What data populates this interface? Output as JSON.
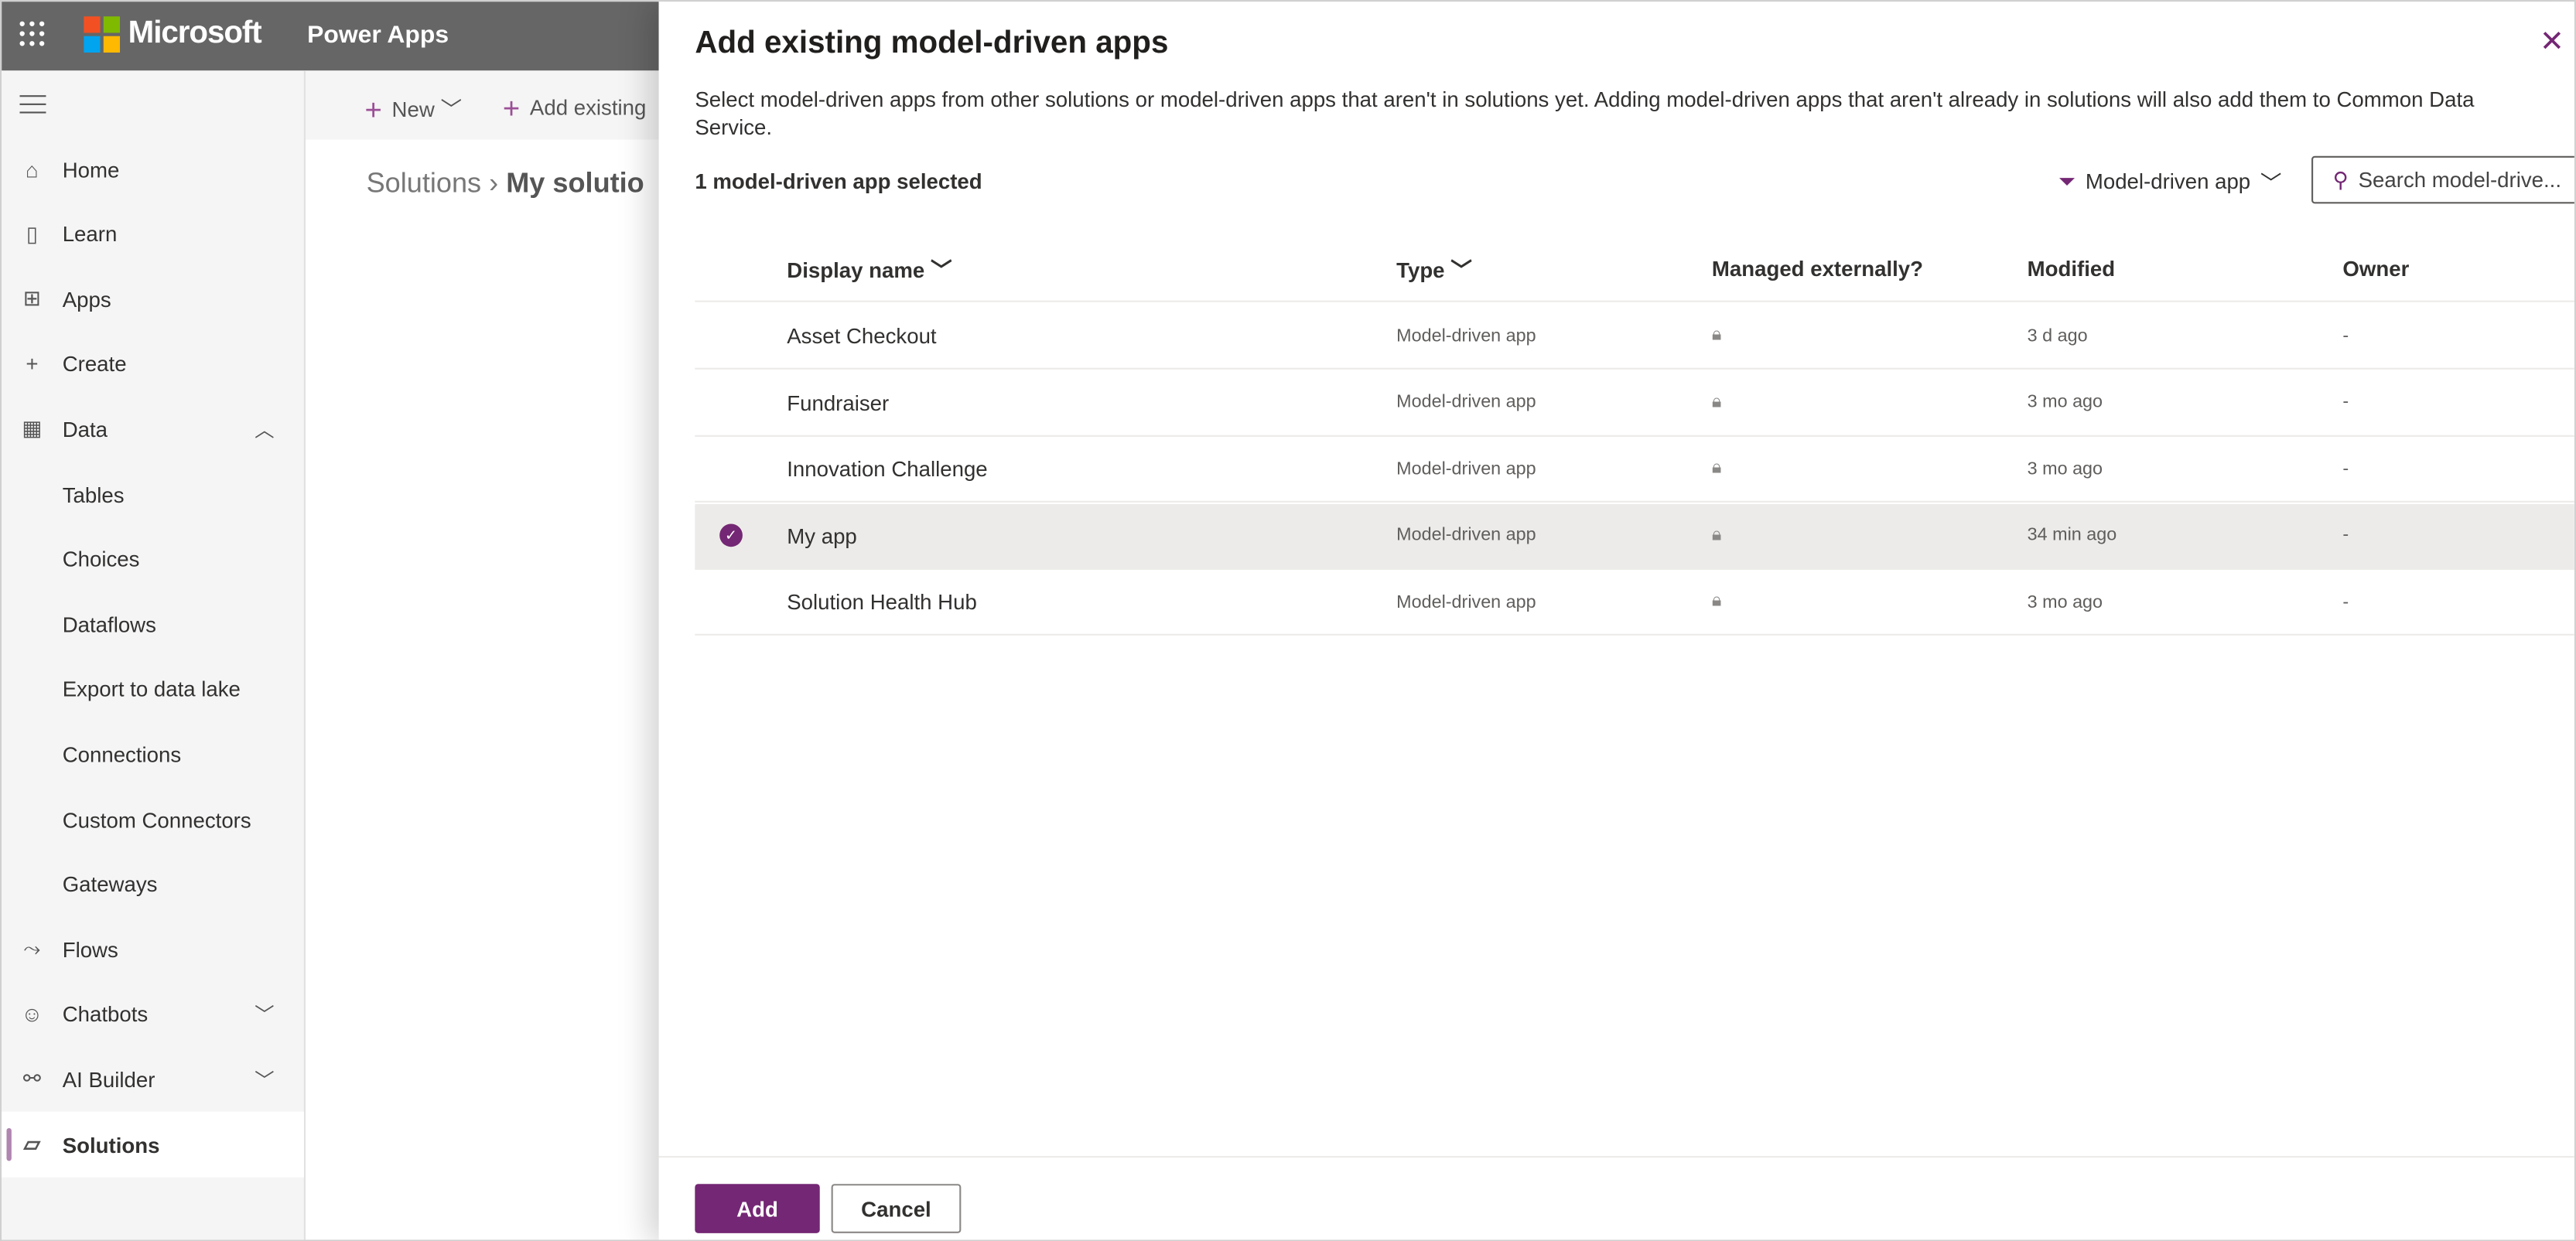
{
  "header": {
    "brand": "Microsoft",
    "app_name": "Power Apps",
    "logo_colors": [
      "#f25022",
      "#7fba00",
      "#00a4ef",
      "#ffb900"
    ]
  },
  "sidebar": {
    "items": [
      {
        "label": "Home",
        "icon": "home-icon",
        "glyph": "⌂"
      },
      {
        "label": "Learn",
        "icon": "book-icon",
        "glyph": "▯"
      },
      {
        "label": "Apps",
        "icon": "apps-icon",
        "glyph": "⊞"
      },
      {
        "label": "Create",
        "icon": "plus-icon",
        "glyph": "+"
      },
      {
        "label": "Data",
        "icon": "table-icon",
        "glyph": "▦",
        "chevron": "︿"
      },
      {
        "label": "Tables",
        "sub": true
      },
      {
        "label": "Choices",
        "sub": true
      },
      {
        "label": "Dataflows",
        "sub": true
      },
      {
        "label": "Export to data lake",
        "sub": true
      },
      {
        "label": "Connections",
        "sub": true
      },
      {
        "label": "Custom Connectors",
        "sub": true
      },
      {
        "label": "Gateways",
        "sub": true
      },
      {
        "label": "Flows",
        "icon": "flow-icon",
        "glyph": "⤳"
      },
      {
        "label": "Chatbots",
        "icon": "bot-icon",
        "glyph": "☺",
        "chevron": "﹀"
      },
      {
        "label": "AI Builder",
        "icon": "ai-icon",
        "glyph": "⚯",
        "chevron": "﹀"
      },
      {
        "label": "Solutions",
        "icon": "solutions-icon",
        "glyph": "▱",
        "selected": true
      }
    ]
  },
  "commandbar": {
    "new_label": "New",
    "add_existing_label": "Add existing"
  },
  "breadcrumb": {
    "root": "Solutions",
    "current": "My solutio"
  },
  "panel": {
    "title": "Add existing model-driven apps",
    "description": "Select model-driven apps from other solutions or model-driven apps that aren't in solutions yet. Adding model-driven apps that aren't already in solutions will also add them to Common Data Service.",
    "selected_count": "1 model-driven app selected",
    "filter_label": "Model-driven app",
    "search_placeholder": "Search model-drive...",
    "columns": [
      "Display name",
      "Type",
      "Managed externally?",
      "Modified",
      "Owner"
    ],
    "rows": [
      {
        "name": "Asset Checkout",
        "type": "Model-driven app",
        "modified": "3 d ago",
        "owner": "-",
        "selected": false
      },
      {
        "name": "Fundraiser",
        "type": "Model-driven app",
        "modified": "3 mo ago",
        "owner": "-",
        "selected": false
      },
      {
        "name": "Innovation Challenge",
        "type": "Model-driven app",
        "modified": "3 mo ago",
        "owner": "-",
        "selected": false
      },
      {
        "name": "My app",
        "type": "Model-driven app",
        "modified": "34 min ago",
        "owner": "-",
        "selected": true
      },
      {
        "name": "Solution Health Hub",
        "type": "Model-driven app",
        "modified": "3 mo ago",
        "owner": "-",
        "selected": false
      }
    ],
    "add_label": "Add",
    "cancel_label": "Cancel",
    "accent": "#742774"
  }
}
